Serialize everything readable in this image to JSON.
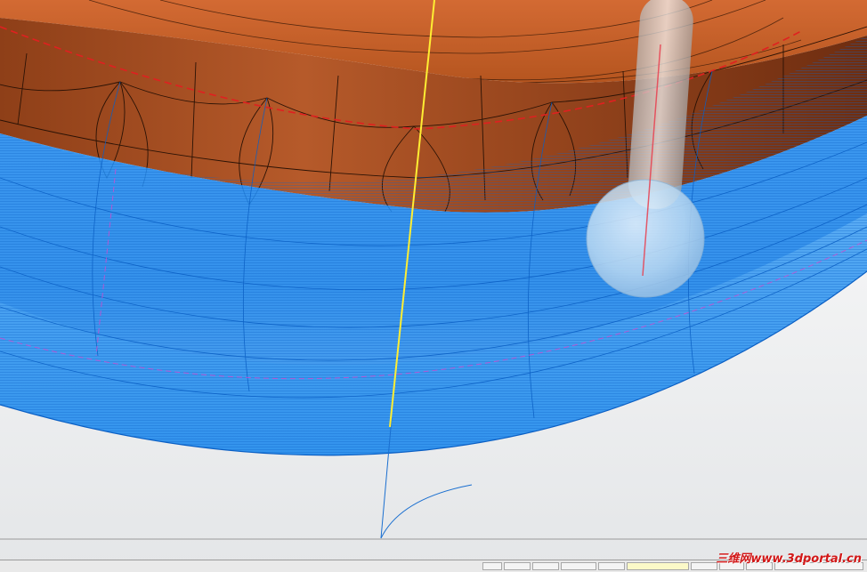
{
  "app": {
    "view": "toolpath-simulation",
    "colors": {
      "part_orange": "#c8622c",
      "part_orange_dark": "#7a3414",
      "toolpath_blue": "#1a84e6",
      "toolpath_line": "#0a5fc4",
      "axis_yellow": "#ffee33",
      "boundary_red": "#e02020",
      "background": "#ffffff",
      "tool_shank": "#c9c9c9"
    }
  },
  "statusbar": {
    "cells": [
      "",
      "",
      "",
      "",
      "",
      "",
      "",
      "",
      "",
      ""
    ]
  },
  "watermark": {
    "text": "三维网www.3dportal.cn"
  }
}
